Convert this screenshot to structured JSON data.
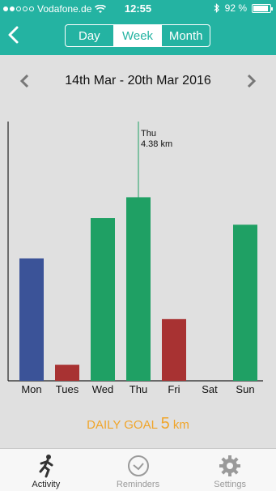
{
  "status_bar": {
    "carrier": "Vodafone.de",
    "time": "12:55",
    "battery_text": "92 %",
    "battery_level": 0.92
  },
  "header": {
    "segments": [
      {
        "label": "Day",
        "active": false
      },
      {
        "label": "Week",
        "active": true
      },
      {
        "label": "Month",
        "active": false
      }
    ]
  },
  "week_nav": {
    "label": "14th Mar - 20th Mar 2016"
  },
  "chart_data": {
    "type": "bar",
    "categories": [
      "Mon",
      "Tues",
      "Wed",
      "Thu",
      "Fri",
      "Sat",
      "Sun"
    ],
    "values": [
      2.36,
      0.31,
      3.14,
      3.54,
      1.19,
      0,
      3.01
    ],
    "bar_colors": [
      "#3b5398",
      "#a83232",
      "#1fa064",
      "#1fa064",
      "#a83232",
      "#1fa064",
      "#1fa064"
    ],
    "title": "",
    "xlabel": "",
    "ylabel": "",
    "ylim": [
      0,
      5
    ],
    "grid": false,
    "selected": {
      "index": 3,
      "label": "Thu",
      "value_text": "4.38 km"
    },
    "marker_color": "#1fa064"
  },
  "goal": {
    "label": "DAILY GOAL",
    "value": "5",
    "unit": "km"
  },
  "tabbar": {
    "tabs": [
      {
        "label": "Activity",
        "icon": "runner-icon",
        "active": true
      },
      {
        "label": "Reminders",
        "icon": "clock-icon",
        "active": false
      },
      {
        "label": "Settings",
        "icon": "gear-icon",
        "active": false
      }
    ]
  },
  "colors": {
    "accent": "#24b3a2",
    "goal": "#f0a52a",
    "background": "#e0e0e0"
  }
}
